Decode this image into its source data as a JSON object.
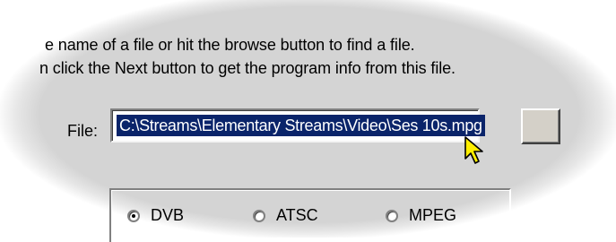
{
  "instructions": {
    "line1": "e name of a file or hit the browse button to find a file.",
    "line2": "n click the Next button to get the program info from this file."
  },
  "file": {
    "label": "File:",
    "value": "C:\\Streams\\Elementary Streams\\Video\\Ses 10s.mpg",
    "browse_label": ""
  },
  "stream_type": {
    "options": [
      {
        "label": "DVB",
        "selected": true
      },
      {
        "label": "ATSC",
        "selected": false
      },
      {
        "label": "MPEG",
        "selected": false
      }
    ]
  },
  "icons": {
    "cursor": "arrow-cursor-icon"
  },
  "colors": {
    "selection": "#0a246a",
    "cursor_fill": "#ffee00",
    "dialog_bg": "#d4d0c8"
  }
}
